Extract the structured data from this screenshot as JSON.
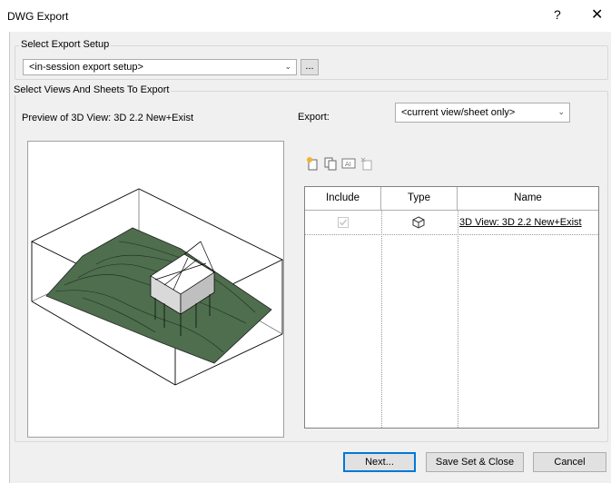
{
  "window": {
    "title": "DWG Export",
    "help_glyph": "?",
    "close_glyph": "✕"
  },
  "export_setup": {
    "group_label": "Select Export Setup",
    "combo_value": "<in-session export setup>",
    "browse_label": "..."
  },
  "views": {
    "group_label": "Select Views And Sheets To Export",
    "preview_label": "Preview of 3D View: 3D 2.2 New+Exist",
    "export_label": "Export:",
    "export_value": "<current view/sheet only>"
  },
  "toolbar_icons": [
    "new-set-icon",
    "duplicate-set-icon",
    "rename-set-icon",
    "delete-set-icon"
  ],
  "table": {
    "columns": [
      "Include",
      "Type",
      "Name"
    ],
    "rows": [
      {
        "include": true,
        "type_icon": "3d-view-icon",
        "name": "3D View: 3D 2.2 New+Exist"
      }
    ]
  },
  "buttons": {
    "next": "Next...",
    "save": "Save Set & Close",
    "cancel": "Cancel"
  },
  "colors": {
    "accent": "#0078d7",
    "terrain": "#4e6e4e"
  }
}
